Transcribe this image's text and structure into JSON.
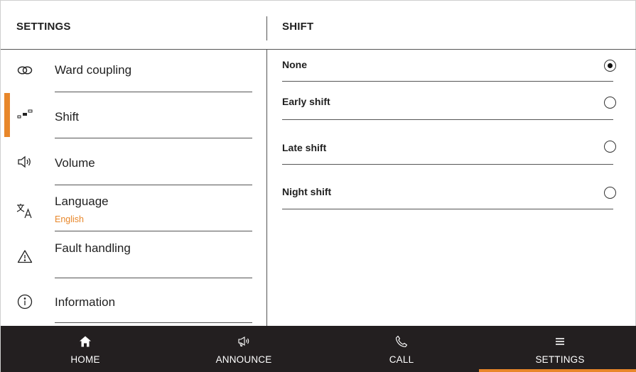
{
  "header": {
    "left_title": "SETTINGS",
    "right_title": "SHIFT"
  },
  "menu": [
    {
      "label": "Ward coupling",
      "icon": "link-icon",
      "active": false
    },
    {
      "label": "Shift",
      "icon": "shift-icon",
      "active": true
    },
    {
      "label": "Volume",
      "icon": "speaker-icon",
      "active": false
    },
    {
      "label": "Language",
      "sublabel": "English",
      "icon": "translate-icon",
      "active": false
    },
    {
      "label": "Fault handling",
      "icon": "warning-icon",
      "active": false
    },
    {
      "label": "Information",
      "icon": "info-icon",
      "active": false
    }
  ],
  "shift_options": [
    {
      "label": "None",
      "selected": true
    },
    {
      "label": "Early shift",
      "selected": false
    },
    {
      "label": "Late shift",
      "selected": false
    },
    {
      "label": "Night shift",
      "selected": false
    }
  ],
  "tabs": [
    {
      "label": "HOME",
      "icon": "home-icon",
      "active": false
    },
    {
      "label": "ANNOUNCE",
      "icon": "megaphone-icon",
      "active": false
    },
    {
      "label": "CALL",
      "icon": "phone-icon",
      "active": false
    },
    {
      "label": "SETTINGS",
      "icon": "menu-icon",
      "active": true
    }
  ],
  "colors": {
    "accent": "#e8872a",
    "bottom_bar": "#231f20",
    "text": "#1f1f1f"
  }
}
